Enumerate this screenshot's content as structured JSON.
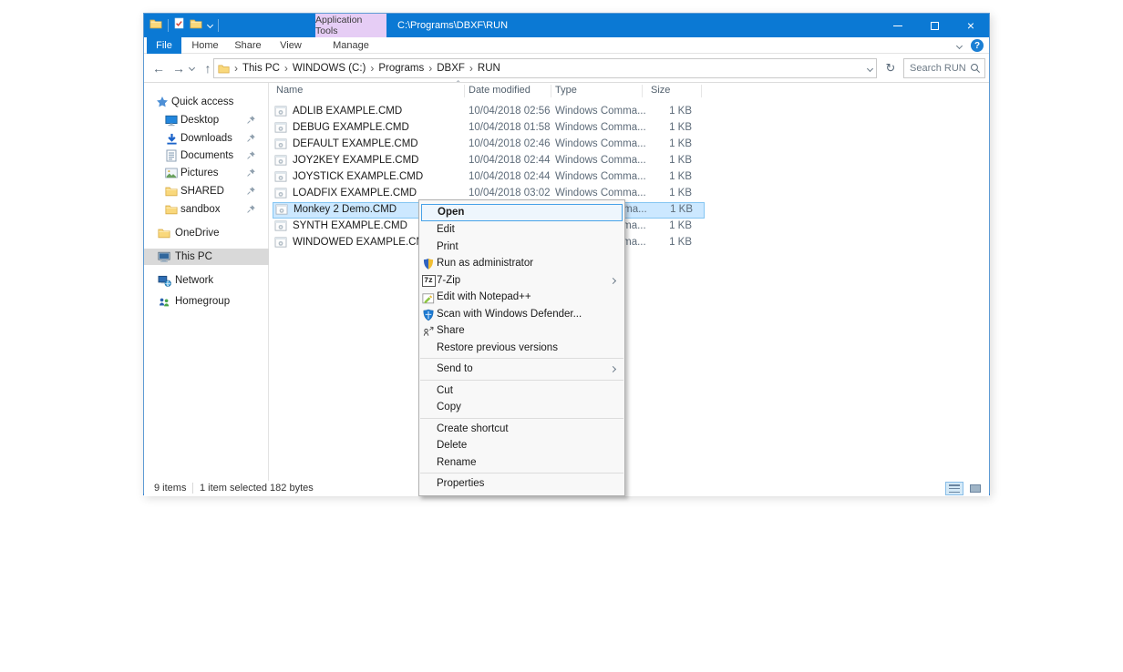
{
  "titlebar": {
    "title": "C:\\Programs\\DBXF\\RUN",
    "contextual_tab": "Application Tools"
  },
  "ribbon": {
    "tabs": [
      {
        "label": "File"
      },
      {
        "label": "Home"
      },
      {
        "label": "Share"
      },
      {
        "label": "View"
      },
      {
        "label": "Manage"
      }
    ],
    "help_glyph": "?"
  },
  "address": {
    "crumbs": [
      "This PC",
      "WINDOWS (C:)",
      "Programs",
      "DBXF",
      "RUN"
    ],
    "search_placeholder": "Search RUN"
  },
  "sidebar": {
    "items": [
      {
        "label": "Quick access",
        "icon": "star"
      },
      {
        "label": "Desktop",
        "icon": "desktop",
        "pinned": true
      },
      {
        "label": "Downloads",
        "icon": "downloads",
        "pinned": true
      },
      {
        "label": "Documents",
        "icon": "documents",
        "pinned": true
      },
      {
        "label": "Pictures",
        "icon": "pictures",
        "pinned": true
      },
      {
        "label": "SHARED",
        "icon": "folder",
        "pinned": true
      },
      {
        "label": "sandbox",
        "icon": "folder",
        "pinned": true
      },
      {
        "label": "OneDrive",
        "icon": "folder"
      },
      {
        "label": "This PC",
        "icon": "computer",
        "selected": true
      },
      {
        "label": "Network",
        "icon": "network"
      },
      {
        "label": "Homegroup",
        "icon": "homegroup"
      }
    ]
  },
  "filelist": {
    "columns": {
      "name": "Name",
      "date": "Date modified",
      "type": "Type",
      "size": "Size"
    },
    "rows": [
      {
        "name": "ADLIB EXAMPLE.CMD",
        "date": "10/04/2018 02:56",
        "type": "Windows Comma...",
        "size": "1 KB"
      },
      {
        "name": "DEBUG EXAMPLE.CMD",
        "date": "10/04/2018 01:58",
        "type": "Windows Comma...",
        "size": "1 KB"
      },
      {
        "name": "DEFAULT EXAMPLE.CMD",
        "date": "10/04/2018 02:46",
        "type": "Windows Comma...",
        "size": "1 KB"
      },
      {
        "name": "JOY2KEY EXAMPLE.CMD",
        "date": "10/04/2018 02:44",
        "type": "Windows Comma...",
        "size": "1 KB"
      },
      {
        "name": "JOYSTICK EXAMPLE.CMD",
        "date": "10/04/2018 02:44",
        "type": "Windows Comma...",
        "size": "1 KB"
      },
      {
        "name": "LOADFIX EXAMPLE.CMD",
        "date": "10/04/2018 03:02",
        "type": "Windows Comma...",
        "size": "1 KB"
      },
      {
        "name": "Monkey 2 Demo.CMD",
        "date": "",
        "type": "Windows Comma...",
        "size": "1 KB",
        "selected": true
      },
      {
        "name": "SYNTH EXAMPLE.CMD",
        "date": "",
        "type": "Windows Comma...",
        "size": "1 KB"
      },
      {
        "name": "WINDOWED EXAMPLE.CMD",
        "date": "",
        "type": "Windows Comma...",
        "size": "1 KB"
      }
    ]
  },
  "context_menu": {
    "items": [
      {
        "label": "Open",
        "default": true
      },
      {
        "label": "Edit"
      },
      {
        "label": "Print"
      },
      {
        "label": "Run as administrator",
        "icon": "uac-shield"
      },
      {
        "label": "7-Zip",
        "icon": "7zip",
        "submenu": true
      },
      {
        "label": "Edit with Notepad++",
        "icon": "notepad-plus-plus"
      },
      {
        "label": "Scan with Windows Defender...",
        "icon": "defender-shield"
      },
      {
        "label": "Share",
        "icon": "share"
      },
      {
        "label": "Restore previous versions"
      },
      {
        "label": "Send to",
        "submenu": true
      },
      {
        "label": "Cut"
      },
      {
        "label": "Copy"
      },
      {
        "label": "Create shortcut"
      },
      {
        "label": "Delete"
      },
      {
        "label": "Rename"
      },
      {
        "label": "Properties"
      }
    ]
  },
  "status_bar": {
    "count": "9 items",
    "selection": "1 item selected 182 bytes"
  },
  "colors": {
    "accent": "#0b79d4",
    "selection_fill": "#cce8ff",
    "selection_border": "#84c5f2",
    "contextual_tab_fill": "#e6cdf5"
  }
}
